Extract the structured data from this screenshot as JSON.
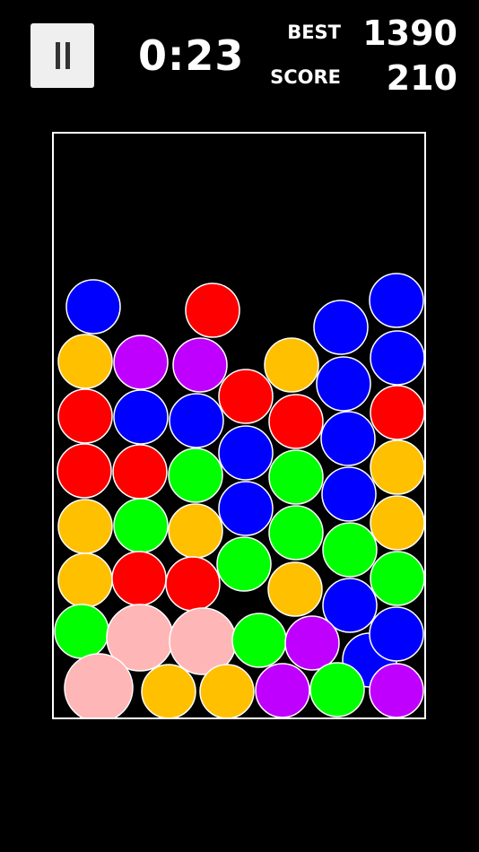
{
  "hud": {
    "pause_icon": "pause-icon",
    "timer": "0:23",
    "best_label": "BEST",
    "best_value": "1390",
    "score_label": "SCORE",
    "score_value": "210"
  },
  "colors": {
    "blue": "#0000ff",
    "red": "#ff0000",
    "yellow": "#ffc000",
    "purple": "#c000ff",
    "green": "#00ff00",
    "pink": "#ffb6b6"
  },
  "balls": [
    {
      "c": "blue"
    },
    {
      "c": "red"
    },
    {
      "c": "blue"
    },
    {
      "c": "blue"
    },
    {
      "c": "yellow"
    },
    {
      "c": "purple"
    },
    {
      "c": "purple"
    },
    {
      "c": "yellow"
    },
    {
      "c": "blue"
    },
    {
      "c": "blue"
    },
    {
      "c": "red"
    },
    {
      "c": "blue"
    },
    {
      "c": "blue"
    },
    {
      "c": "red"
    },
    {
      "c": "red"
    },
    {
      "c": "blue"
    },
    {
      "c": "red"
    },
    {
      "c": "red"
    },
    {
      "c": "red"
    },
    {
      "c": "green"
    },
    {
      "c": "blue"
    },
    {
      "c": "green"
    },
    {
      "c": "blue"
    },
    {
      "c": "yellow"
    },
    {
      "c": "yellow"
    },
    {
      "c": "green"
    },
    {
      "c": "yellow"
    },
    {
      "c": "blue"
    },
    {
      "c": "green"
    },
    {
      "c": "green"
    },
    {
      "c": "yellow"
    },
    {
      "c": "yellow"
    },
    {
      "c": "red"
    },
    {
      "c": "red"
    },
    {
      "c": "green"
    },
    {
      "c": "yellow"
    },
    {
      "c": "blue"
    },
    {
      "c": "green"
    },
    {
      "c": "green"
    },
    {
      "c": "pink"
    },
    {
      "c": "pink"
    },
    {
      "c": "green"
    },
    {
      "c": "purple"
    },
    {
      "c": "blue"
    },
    {
      "c": "blue"
    },
    {
      "c": "pink"
    },
    {
      "c": "yellow"
    },
    {
      "c": "yellow"
    },
    {
      "c": "purple"
    },
    {
      "c": "green"
    },
    {
      "c": "purple"
    }
  ]
}
